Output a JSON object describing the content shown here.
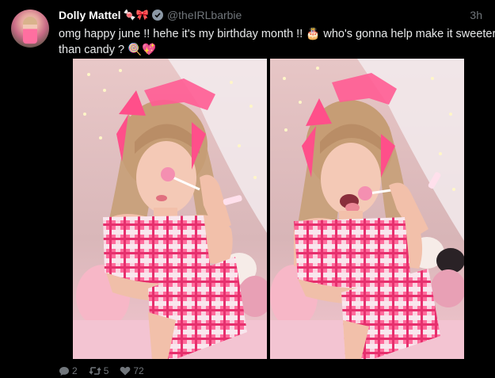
{
  "tweet": {
    "author_name": "Dolly Mattel",
    "name_emojis": "🍬🎀",
    "handle": "@theIRLbarbie",
    "time": "3h",
    "text_line1": "omg happy june !! hehe it's my birthday month !! 🎂 who's gonna help make it sweeter",
    "text_line2": "than candy ? 🍭💖",
    "replies": "2",
    "retweets": "5",
    "likes": "72"
  },
  "colors": {
    "background": "#000000",
    "text": "#e7e9ea",
    "muted": "#71767b",
    "verified": "#8b98a5",
    "plaid_pink": "#ff5c93",
    "bow_pink": "#ff4f8a"
  },
  "icons": {
    "verified": "verified-badge-icon",
    "reply": "reply-icon",
    "retweet": "retweet-icon",
    "like": "heart-icon"
  }
}
